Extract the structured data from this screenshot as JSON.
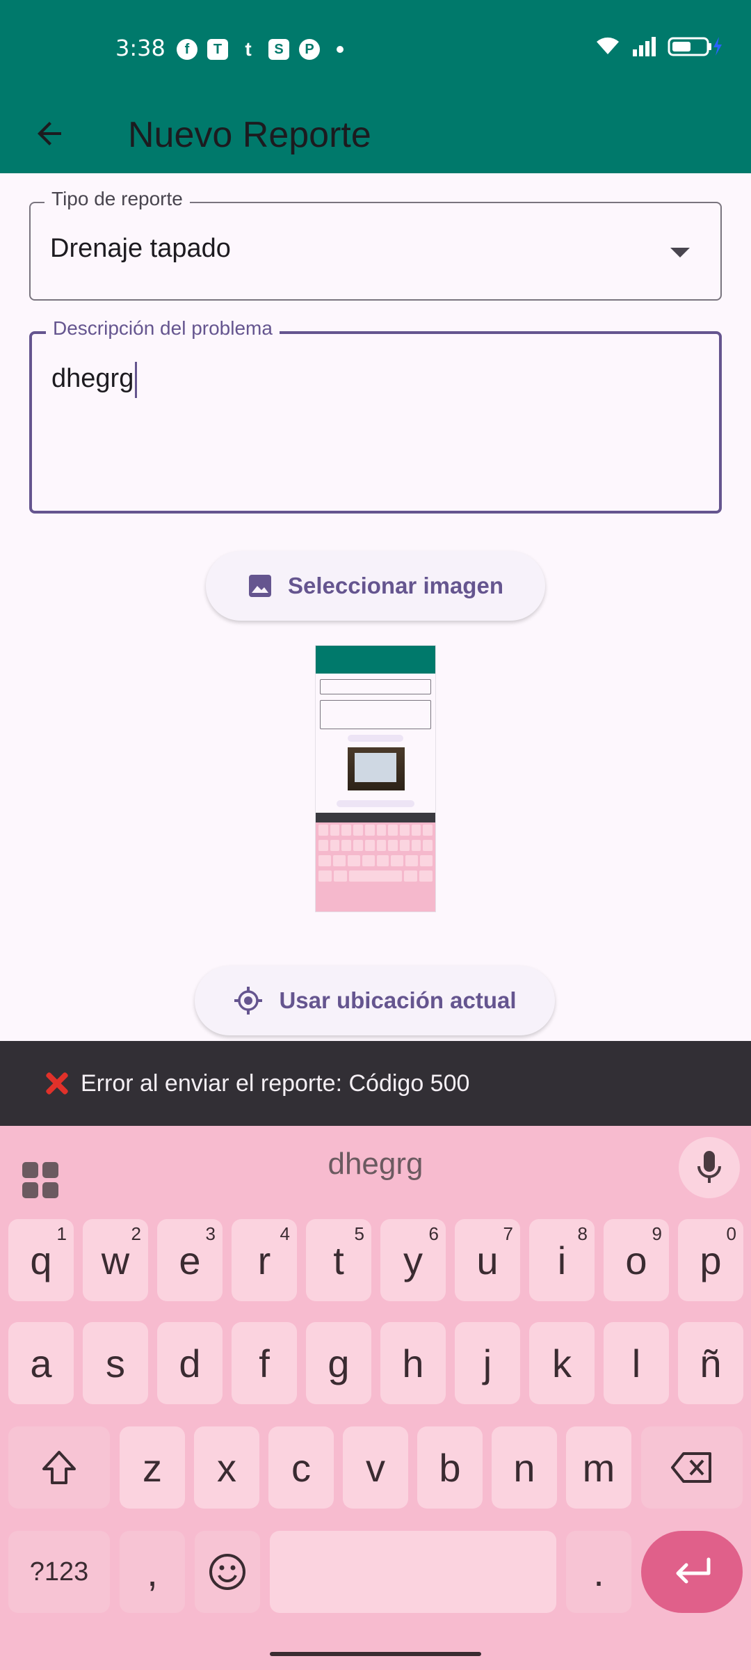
{
  "status_bar": {
    "time": "3:38",
    "app_icons": [
      "facebook-icon",
      "teams-icon",
      "tumblr-icon",
      "skype-icon",
      "pinterest-icon"
    ],
    "right_icons": [
      "wifi-icon",
      "signal-icon",
      "battery-charging-icon"
    ]
  },
  "app_bar": {
    "title": "Nuevo Reporte",
    "color": "#00796b"
  },
  "form": {
    "report_type": {
      "label": "Tipo de reporte",
      "value": "Drenaje tapado"
    },
    "description": {
      "label": "Descripción del problema",
      "value": "dhegrg"
    },
    "select_image_label": "Seleccionar imagen",
    "use_location_label": "Usar ubicación actual"
  },
  "snackbar": {
    "message": "Error al enviar el reporte: Código 500"
  },
  "keyboard": {
    "suggestion": "dhegrg",
    "row1": [
      {
        "k": "q",
        "h": "1"
      },
      {
        "k": "w",
        "h": "2"
      },
      {
        "k": "e",
        "h": "3"
      },
      {
        "k": "r",
        "h": "4"
      },
      {
        "k": "t",
        "h": "5"
      },
      {
        "k": "y",
        "h": "6"
      },
      {
        "k": "u",
        "h": "7"
      },
      {
        "k": "i",
        "h": "8"
      },
      {
        "k": "o",
        "h": "9"
      },
      {
        "k": "p",
        "h": "0"
      }
    ],
    "row2": [
      "a",
      "s",
      "d",
      "f",
      "g",
      "h",
      "j",
      "k",
      "l",
      "ñ"
    ],
    "row3": [
      "z",
      "x",
      "c",
      "v",
      "b",
      "n",
      "m"
    ],
    "symbols_key": "?123",
    "comma_key": ",",
    "period_key": ".",
    "accent_color": "#e0608a"
  }
}
